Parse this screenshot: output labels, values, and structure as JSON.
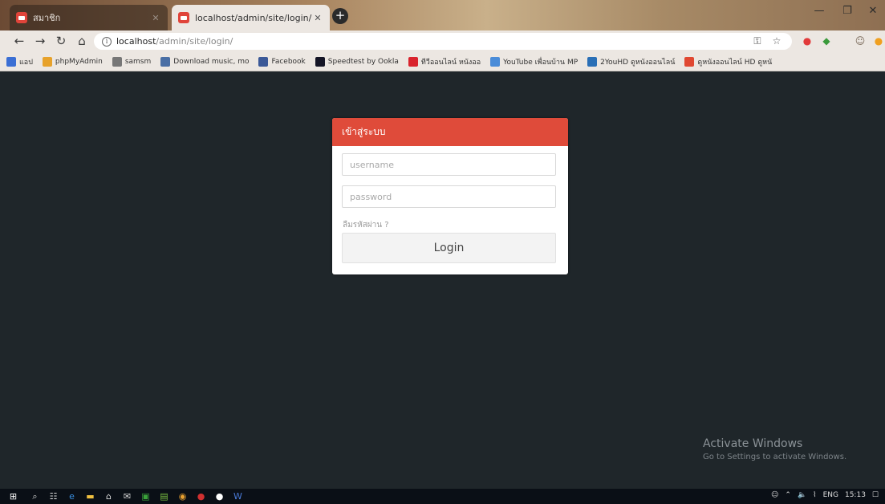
{
  "browser": {
    "tabs": [
      {
        "title": "สมาชิก",
        "active": false
      },
      {
        "title": "localhost/admin/site/login/",
        "active": true
      }
    ],
    "url_host": "localhost",
    "url_path": "/admin/site/login/",
    "bookmarks": [
      {
        "label": "แอป",
        "icon": "apps-grid-icon",
        "color": "#3b6fd4"
      },
      {
        "label": "phpMyAdmin",
        "icon": "phpmyadmin-icon",
        "color": "#e7a22b"
      },
      {
        "label": "samsm",
        "icon": "page-icon",
        "color": "#777777"
      },
      {
        "label": "Download music, mo",
        "icon": "download-icon",
        "color": "#4a6fa5"
      },
      {
        "label": "Facebook",
        "icon": "facebook-icon",
        "color": "#3b5998"
      },
      {
        "label": "Speedtest by Ookla",
        "icon": "speedtest-icon",
        "color": "#141526"
      },
      {
        "label": "ทีวีออนไลน์ หนังออ",
        "icon": "tv-icon",
        "color": "#d9232d"
      },
      {
        "label": "YouTube เพื่อนบ้าน MP",
        "icon": "youtube-icon",
        "color": "#4a8cd8"
      },
      {
        "label": "2YouHD ดูหนังออนไลน์",
        "icon": "movie-icon",
        "color": "#2a6fb6"
      },
      {
        "label": "ดูหนังออนไลน์ HD ดูหนั",
        "icon": "hd-icon",
        "color": "#e04832"
      }
    ]
  },
  "login": {
    "header": "เข้าสู่ระบบ",
    "username_placeholder": "username",
    "password_placeholder": "password",
    "forgot": "ลืมรหัสผ่าน ?",
    "button": "Login"
  },
  "watermark": {
    "title": "Activate Windows",
    "subtitle": "Go to Settings to activate Windows."
  },
  "taskbar": {
    "language": "ENG",
    "time": "15:13"
  },
  "colors": {
    "accent": "#df4b3a",
    "page_background": "#1f262a"
  }
}
